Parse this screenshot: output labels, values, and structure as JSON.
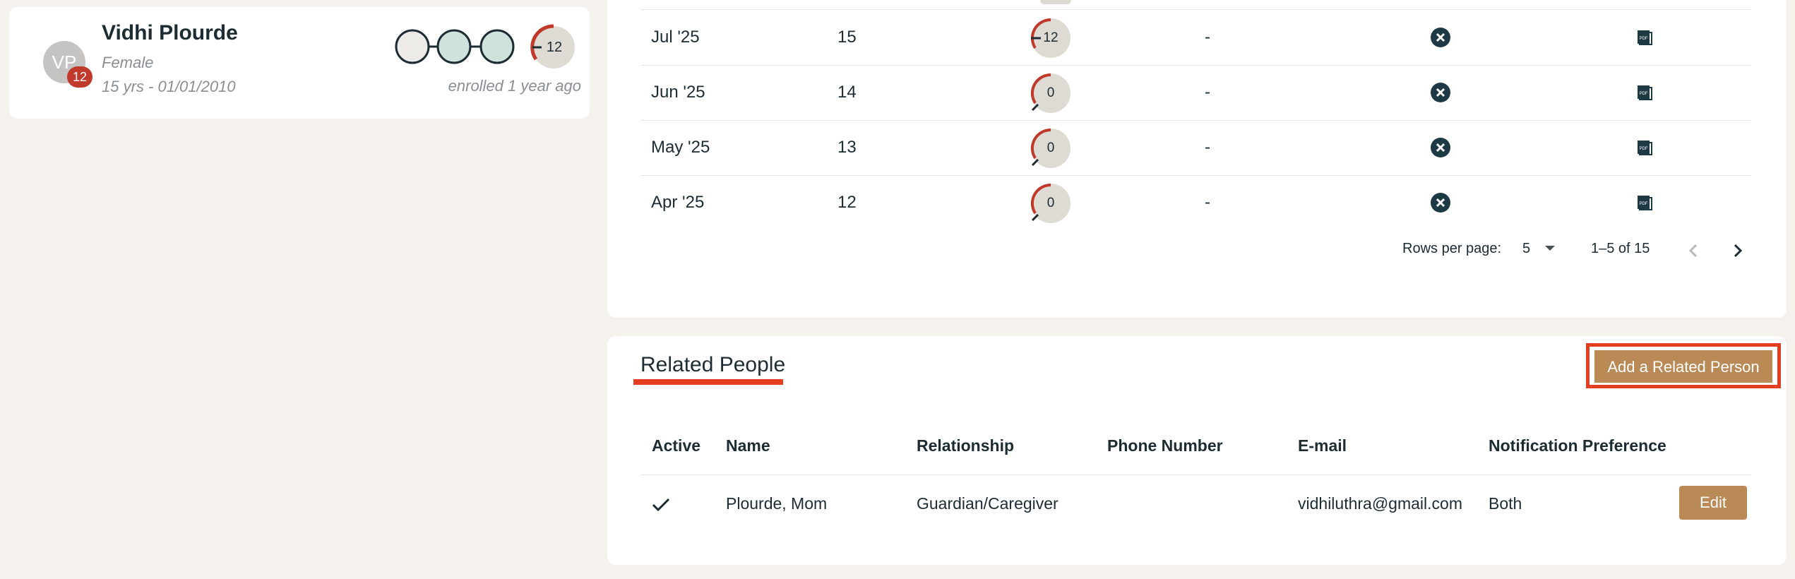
{
  "patient": {
    "initials": "VP",
    "badge": "12",
    "name": "Vidhi Plourde",
    "gender": "Female",
    "age_dob": "15 yrs - 01/01/2010",
    "enrolled": "enrolled 1 year ago",
    "score": "12"
  },
  "history": {
    "rows": [
      {
        "month": "Jul '25",
        "number": "15",
        "score": "12",
        "dash": "-"
      },
      {
        "month": "Jun '25",
        "number": "14",
        "score": "0",
        "dash": "-"
      },
      {
        "month": "May '25",
        "number": "13",
        "score": "0",
        "dash": "-"
      },
      {
        "month": "Apr '25",
        "number": "12",
        "score": "0",
        "dash": "-"
      }
    ],
    "pagination": {
      "rows_per_page_label": "Rows per page:",
      "rows_per_page": "5",
      "range": "1–5 of 15"
    }
  },
  "related_people": {
    "title": "Related People",
    "add_button": "Add a Related Person",
    "columns": [
      "Active",
      "Name",
      "Relationship",
      "Phone Number",
      "E-mail",
      "Notification Preference"
    ],
    "rows": [
      {
        "active": true,
        "name": "Plourde, Mom",
        "relationship": "Guardian/Caregiver",
        "phone": "",
        "email": "vidhiluthra@gmail.com",
        "preference": "Both",
        "edit": "Edit"
      }
    ]
  },
  "colors": {
    "accent_button": "#b98a55",
    "highlight": "#e43d1f",
    "badge_red": "#c0392b",
    "text_dark": "#1d2b33"
  }
}
